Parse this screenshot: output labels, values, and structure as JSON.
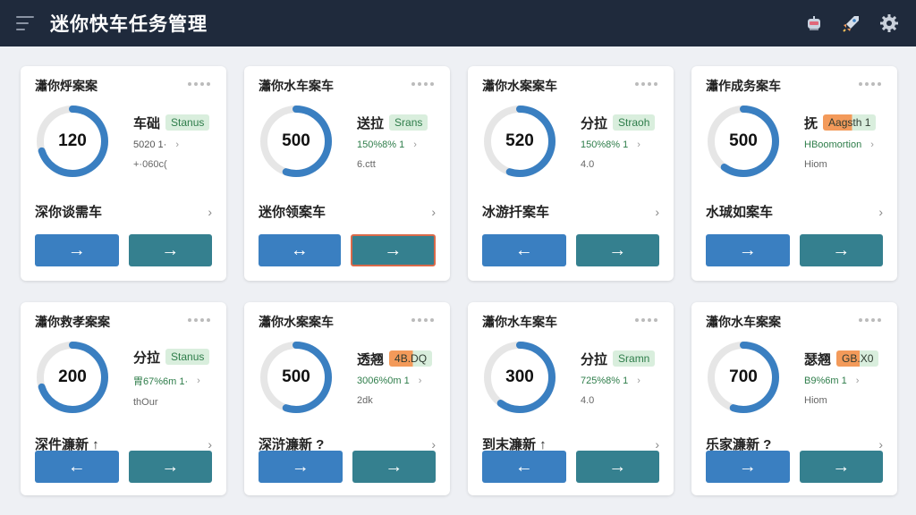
{
  "app": {
    "title": "迷你快车任务管理"
  },
  "colors": {
    "topbar": "#1f2a3c",
    "ring": "#3a7fc1",
    "ring_track": "#e6e6e6",
    "btn_blue": "#3a7fc1",
    "btn_teal": "#35808f",
    "badge_green": "#d9eedd",
    "badge_orange": "#f39a5a"
  },
  "top_icons": [
    "robot-icon",
    "rocket-icon",
    "gear-icon"
  ],
  "cards": [
    {
      "title": "瀟你烀案案",
      "value": "120",
      "progress": 0.7,
      "label": "车础",
      "badge": "Stanus",
      "badge_style": "green",
      "meta1": "5020 1·",
      "meta1_style": "gray",
      "meta2": "+·060c(",
      "link": "深你谈需车",
      "btn1": "→",
      "btn2": "→",
      "btn2_outlined": false
    },
    {
      "title": "瀟你水车案车",
      "value": "500",
      "progress": 0.55,
      "label": "送拉",
      "badge": "Srans",
      "badge_style": "green",
      "meta1": "150%8% 1",
      "meta1_style": "green",
      "meta2": "6.ctt",
      "link": "迷你领案车",
      "btn1": "↔",
      "btn2": "→",
      "btn2_outlined": true
    },
    {
      "title": "瀟你水案案车",
      "value": "520",
      "progress": 0.55,
      "label": "分拉",
      "badge": "Straoh",
      "badge_style": "green",
      "meta1": "150%8% 1",
      "meta1_style": "green",
      "meta2": "4.0",
      "link": "冰游扦案车",
      "btn1": "←",
      "btn2": "→",
      "btn2_outlined": false
    },
    {
      "title": "瀟作成务案车",
      "value": "500",
      "progress": 0.6,
      "label": "抚",
      "badge": "Aagsth 1",
      "badge_style": "orange split",
      "meta1": "HBoomortion",
      "meta1_style": "green",
      "meta2": "Hiom",
      "link": "水珹如案车",
      "btn1": "→",
      "btn2": "→",
      "btn2_outlined": false
    },
    {
      "title": "瀟你救孝案案",
      "value": "200",
      "progress": 0.7,
      "label": "分拉",
      "badge": "Stanus",
      "badge_style": "green",
      "meta1": "胃67%6m 1·",
      "meta1_style": "green",
      "meta2": "thOur",
      "link": "深件濂新 ↑",
      "btn1": "←",
      "btn2": "→",
      "btn2_outlined": false
    },
    {
      "title": "瀟你水案案车",
      "value": "500",
      "progress": 0.55,
      "label": "透翘",
      "badge": "4B.DQ",
      "badge_style": "orange split",
      "meta1": "3006%0m 1",
      "meta1_style": "green",
      "meta2": "2dk",
      "link": "深浒濂新 ?",
      "btn1": "→",
      "btn2": "→",
      "btn2_outlined": false
    },
    {
      "title": "瀟你水车案车",
      "value": "300",
      "progress": 0.6,
      "label": "分拉",
      "badge": "Sramn",
      "badge_style": "green",
      "meta1": "725%8% 1",
      "meta1_style": "green",
      "meta2": "4.0",
      "link": "到末濂新 ↑",
      "btn1": "←",
      "btn2": "→",
      "btn2_outlined": false
    },
    {
      "title": "瀟你水车案案",
      "value": "700",
      "progress": 0.55,
      "label": "瑟翘",
      "badge": "GB.X0",
      "badge_style": "orange split",
      "meta1": "B9%6m 1",
      "meta1_style": "green",
      "meta2": "Hiom",
      "link": "乐家濂新 ?",
      "btn1": "→",
      "btn2": "→",
      "btn2_outlined": false
    }
  ]
}
